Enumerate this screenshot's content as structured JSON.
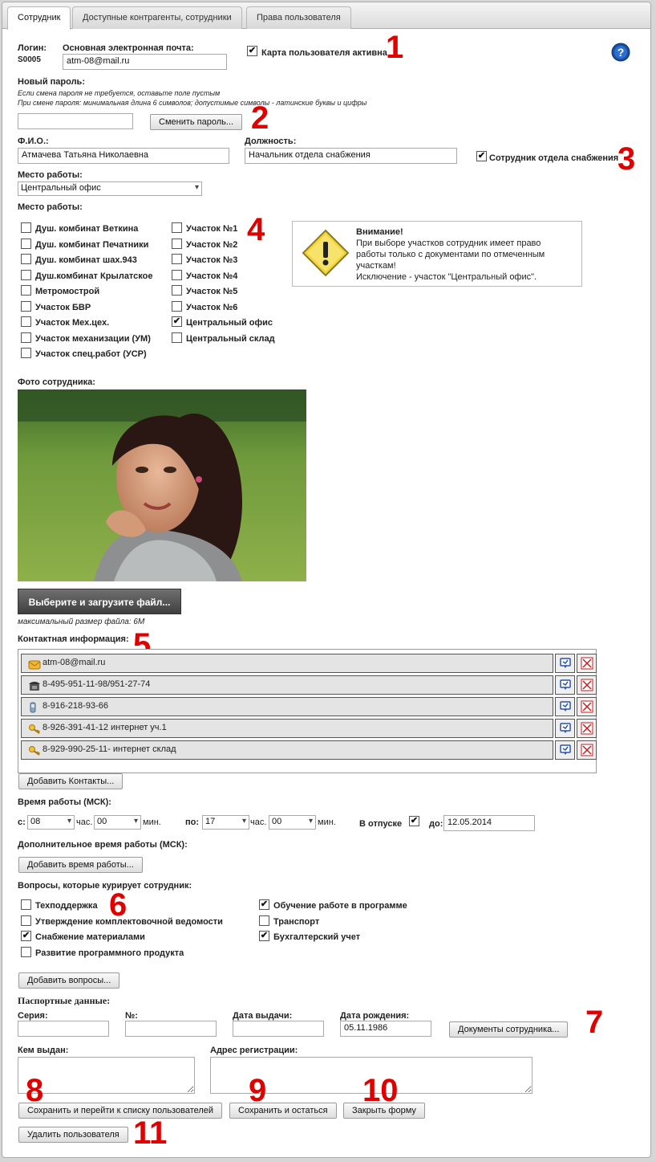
{
  "tabs": [
    "Сотрудник",
    "Доступные контрагенты, сотрудники",
    "Права пользователя"
  ],
  "login": {
    "label": "Логин:",
    "value": "S0005"
  },
  "email": {
    "label": "Основная электронная почта:",
    "value": "atm-08@mail.ru"
  },
  "card_active": {
    "label": "Карта пользователя активна",
    "checked": true
  },
  "password": {
    "label": "Новый пароль:",
    "hint1": "Если смена пароля не требуется, оставьте поле пустым",
    "hint2": "При смене пароля: минимальная длина 6 символов; допустимые символы - латинские буквы и цифры",
    "button": "Сменить пароль..."
  },
  "fio": {
    "label": "Ф.И.О.:",
    "value": "Атмачева Татьяна Николаевна"
  },
  "position": {
    "label": "Должность:",
    "value": "Начальник отдела снабжения"
  },
  "supply_dept": {
    "label": "Сотрудник отдела снабжения",
    "checked": true
  },
  "workplace_select": {
    "label": "Место работы:",
    "value": "Центральный офис"
  },
  "workplaces": {
    "label": "Место работы:",
    "col1": [
      {
        "label": "Душ. комбинат Веткина",
        "checked": false
      },
      {
        "label": "Душ. комбинат Печатники",
        "checked": false
      },
      {
        "label": "Душ. комбинат шах.943",
        "checked": false
      },
      {
        "label": "Душ.комбинат Крылатское",
        "checked": false
      },
      {
        "label": "Метромострой",
        "checked": false
      },
      {
        "label": "Участок БВР",
        "checked": false
      },
      {
        "label": "Участок Мех.цех.",
        "checked": false
      },
      {
        "label": "Участок механизации (УМ)",
        "checked": false
      },
      {
        "label": "Участок спец.работ (УСР)",
        "checked": false
      }
    ],
    "col2": [
      {
        "label": "Участок №1",
        "checked": false
      },
      {
        "label": "Участок №2",
        "checked": false
      },
      {
        "label": "Участок №3",
        "checked": false
      },
      {
        "label": "Участок №4",
        "checked": false
      },
      {
        "label": "Участок №5",
        "checked": false
      },
      {
        "label": "Участок №6",
        "checked": false
      },
      {
        "label": "Центральный офис",
        "checked": true
      },
      {
        "label": "Центральный склад",
        "checked": false
      }
    ]
  },
  "warning": {
    "title": "Внимание!",
    "line1": "При выборе участков сотрудник имеет право",
    "line2": "работы только с документами по отмеченным",
    "line3": "участкам!",
    "line4": "Исключение - участок \"Центральный офис\"."
  },
  "photo": {
    "label": "Фото сотрудника:",
    "upload_button": "Выберите и загрузите файл...",
    "max_size": "максимальный размер файла: 6M"
  },
  "contacts": {
    "label": "Контактная информация:",
    "items": [
      {
        "value": "atm-08@mail.ru",
        "icon": "email-icon"
      },
      {
        "value": "8-495-951-11-98/951-27-74",
        "icon": "phone-icon"
      },
      {
        "value": "8-916-218-93-66",
        "icon": "mobile-icon"
      },
      {
        "value": "8-926-391-41-12 интернет уч.1",
        "icon": "key-icon"
      },
      {
        "value": "8-929-990-25-11- интернет склад",
        "icon": "key-icon"
      }
    ],
    "add_button": "Добавить Контакты..."
  },
  "work_time": {
    "label": "Время работы (МСК):",
    "from_label": "с:",
    "from_hour": "08",
    "hour_unit": "час.",
    "from_min": "00",
    "min_unit": "мин.",
    "to_label": "по:",
    "to_hour": "17",
    "to_min": "00",
    "vacation_label": "В отпуске",
    "vacation_checked": true,
    "until_label": "до:",
    "until_value": "12.05.2014"
  },
  "extra_time": {
    "label": "Дополнительное время работы (МСК):",
    "button": "Добавить время работы..."
  },
  "questions": {
    "label": "Вопросы, которые курирует сотрудник:",
    "col1": [
      {
        "label": "Техподдержка",
        "checked": false
      },
      {
        "label": "Утверждение комплектовочной ведомости",
        "checked": false
      },
      {
        "label": "Снабжение материалами",
        "checked": true
      },
      {
        "label": "Развитие программного продукта",
        "checked": false
      }
    ],
    "col2": [
      {
        "label": "Обучение работе в программе",
        "checked": true
      },
      {
        "label": "Транспорт",
        "checked": false
      },
      {
        "label": "Бухгалтерский учет",
        "checked": true
      }
    ],
    "add_button": "Добавить вопросы..."
  },
  "passport": {
    "label": "Паспортные данные:",
    "series_label": "Серия:",
    "series_value": "",
    "number_label": "№:",
    "number_value": "",
    "issue_date_label": "Дата выдачи:",
    "issue_date_value": "",
    "birth_date_label": "Дата рождения:",
    "birth_date_value": "05.11.1986",
    "docs_button": "Документы сотрудника...",
    "issued_by_label": "Кем выдан:",
    "address_label": "Адрес регистрации:"
  },
  "actions": {
    "save_go": "Сохранить и перейти к списку пользователей",
    "save_stay": "Сохранить и остаться",
    "close": "Закрыть форму",
    "delete": "Удалить пользователя"
  },
  "annotations": [
    "1",
    "2",
    "3",
    "4",
    "5",
    "6",
    "7",
    "8",
    "9",
    "10",
    "11"
  ],
  "colors": {
    "annotation": "#e00000",
    "help_icon": "#1a4fa0",
    "warning_icon": "#f2d43a"
  }
}
